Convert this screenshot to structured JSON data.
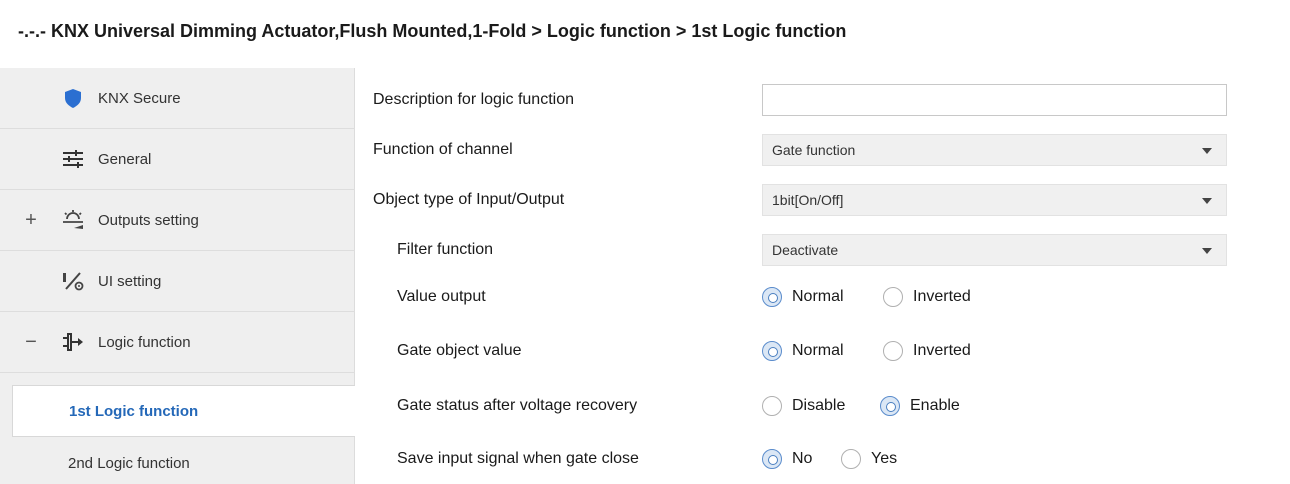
{
  "breadcrumb": "-.-.- KNX Universal Dimming Actuator,Flush Mounted,1-Fold > Logic function > 1st Logic function",
  "sidebar": {
    "items": [
      {
        "label": "KNX Secure",
        "icon": "shield-icon",
        "expander": ""
      },
      {
        "label": "General",
        "icon": "sliders-icon",
        "expander": ""
      },
      {
        "label": "Outputs setting",
        "icon": "outputs-icon",
        "expander": "+"
      },
      {
        "label": "UI setting",
        "icon": "ui-setting-icon",
        "expander": ""
      },
      {
        "label": "Logic function",
        "icon": "logic-icon",
        "expander": "−"
      }
    ],
    "sub_items": [
      {
        "label": "1st Logic function",
        "active": true
      },
      {
        "label": "2nd Logic function",
        "active": false
      }
    ]
  },
  "params": {
    "description": {
      "label": "Description for logic function",
      "value": ""
    },
    "function_of_channel": {
      "label": "Function of channel",
      "value": "Gate function"
    },
    "object_type": {
      "label": "Object type of Input/Output",
      "value": "1bit[On/Off]"
    },
    "filter_function": {
      "label": "Filter function",
      "value": "Deactivate"
    },
    "value_output": {
      "label": "Value output",
      "options": [
        "Normal",
        "Inverted"
      ],
      "selected": "Normal"
    },
    "gate_object_value": {
      "label": "Gate object value",
      "options": [
        "Normal",
        "Inverted"
      ],
      "selected": "Normal"
    },
    "gate_status": {
      "label": "Gate status after voltage recovery",
      "options": [
        "Disable",
        "Enable"
      ],
      "selected": "Enable"
    },
    "save_input": {
      "label": "Save input signal when gate close",
      "options": [
        "No",
        "Yes"
      ],
      "selected": "No"
    }
  },
  "colors": {
    "accent": "#2468b8",
    "shield": "#2b6fd1",
    "sidebar_bg": "#efefef"
  }
}
